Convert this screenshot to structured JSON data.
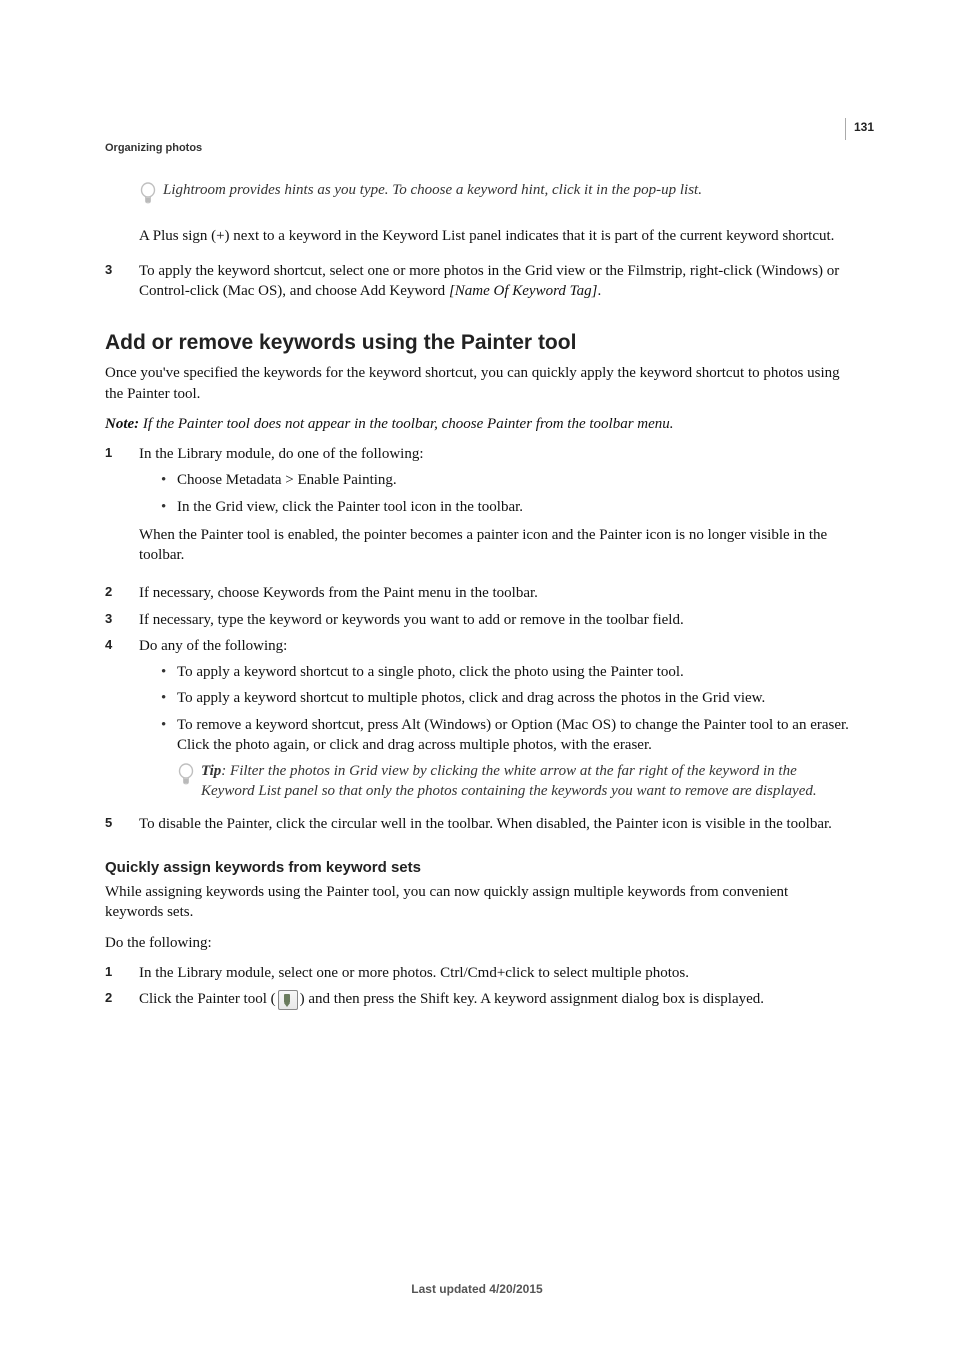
{
  "header": {
    "running_head": "Organizing photos",
    "page_number": "131"
  },
  "intro": {
    "tip": "Lightroom provides hints as you type. To choose a keyword hint, click it in the pop-up list.",
    "plus_sign_sentence": "A Plus sign (+) next to a keyword in the Keyword List panel indicates that it is part of the current keyword shortcut.",
    "step3_num": "3",
    "step3_text_a": "To apply the keyword shortcut, select one or more photos in the Grid view or the Filmstrip, right-click (Windows) or Control-click (Mac OS), and choose Add Keyword ",
    "step3_text_b": "[Name Of Keyword Tag]",
    "step3_text_c": "."
  },
  "section1": {
    "heading": "Add or remove keywords using the Painter tool",
    "p1": "Once you've specified the keywords for the keyword shortcut, you can quickly apply the keyword shortcut to photos using the Painter tool.",
    "note_label": "Note: ",
    "note_text": "If the Painter tool does not appear in the toolbar, choose Painter from the toolbar menu.",
    "steps": {
      "s1_num": "1",
      "s1_text": "In the Library module, do one of the following:",
      "s1_b1": "Choose Metadata > Enable Painting.",
      "s1_b2": "In the Grid view, click the Painter tool icon in the toolbar.",
      "s1_after": "When the Painter tool is enabled, the pointer becomes a painter icon and the Painter icon is no longer visible in the toolbar.",
      "s2_num": "2",
      "s2_text": "If necessary, choose Keywords from the Paint menu in the toolbar.",
      "s3_num": "3",
      "s3_text": "If necessary, type the keyword or keywords you want to add or remove in the toolbar field.",
      "s4_num": "4",
      "s4_text": "Do any of the following:",
      "s4_b1": "To apply a keyword shortcut to a single photo, click the photo using the Painter tool.",
      "s4_b2": "To apply a keyword shortcut to multiple photos, click and drag across the photos in the Grid view.",
      "s4_b3": "To remove a keyword shortcut, press Alt (Windows) or Option (Mac OS) to change the Painter tool to an eraser. Click the photo again, or click and drag across multiple photos, with the eraser.",
      "s4_tip_label": "Tip",
      "s4_tip_text": ": Filter the photos in Grid view by clicking the white arrow at the far right of the keyword in the Keyword List panel so that only the photos containing the keywords you want to remove are displayed.",
      "s5_num": "5",
      "s5_text": "To disable the Painter, click the circular well in the toolbar. When disabled, the Painter icon is visible in the toolbar."
    }
  },
  "section2": {
    "heading": "Quickly assign keywords from keyword sets",
    "p1": "While assigning keywords using the Painter tool, you can now quickly assign multiple keywords from convenient keywords sets.",
    "p2": "Do the following:",
    "s1_num": "1",
    "s1_text": "In the Library module, select one or more photos. Ctrl/Cmd+click to select multiple photos.",
    "s2_num": "2",
    "s2_text_a": "Click the Painter tool (",
    "s2_text_b": ") and then press the Shift key. A keyword assignment dialog box is displayed."
  },
  "footer": {
    "last_updated": "Last updated 4/20/2015"
  }
}
